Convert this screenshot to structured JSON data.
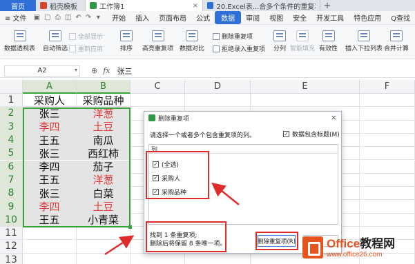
{
  "tabs": {
    "home": "首页",
    "items": [
      {
        "label": "稻壳模板",
        "color": "#d9472b",
        "active": false
      },
      {
        "label": "工作簿1",
        "color": "#2e9a45",
        "active": true
      },
      {
        "label": "20.Excel表...合多个条件的重复项",
        "color": "#2f6fd6",
        "active": false
      }
    ]
  },
  "menu": {
    "file": "≡ 文件",
    "items": [
      "开始",
      "插入",
      "页面布局",
      "公式",
      "数据",
      "审阅",
      "视图",
      "安全",
      "开发工具",
      "特色应用",
      "Q查找"
    ],
    "active": "数据"
  },
  "ribbon": {
    "pivot": "数据透视表",
    "autofilter": "自动筛选",
    "show_all": "全部显示",
    "reapply": "重新应用",
    "sort": "排序",
    "highlight_dup": "高亮重复项",
    "compare": "数据对比",
    "remove_dup": "删除重复项",
    "reject_dup": "拒绝录入重复项",
    "split": "分列",
    "smart_fill": "智能填充",
    "validity": "有效性",
    "dropdown": "插入下拉列表",
    "consolidate": "合并计算"
  },
  "formula_bar": {
    "cell_ref": "A2",
    "fx": "fx",
    "value": "张三"
  },
  "grid": {
    "columns": [
      "A",
      "B",
      "C",
      "D",
      "E",
      "F"
    ],
    "rows": [
      "1",
      "2",
      "3",
      "4",
      "5",
      "6",
      "7",
      "8",
      "9",
      "10",
      "11",
      "12",
      "13"
    ],
    "data": [
      {
        "a": "采购人",
        "b": "采购品种",
        "a_red": false,
        "b_red": false
      },
      {
        "a": "张三",
        "b": "洋葱",
        "a_red": false,
        "b_red": true
      },
      {
        "a": "李四",
        "b": "土豆",
        "a_red": true,
        "b_red": true
      },
      {
        "a": "王五",
        "b": "南瓜",
        "a_red": false,
        "b_red": false
      },
      {
        "a": "张三",
        "b": "西红柿",
        "a_red": false,
        "b_red": false
      },
      {
        "a": "李四",
        "b": "茄子",
        "a_red": false,
        "b_red": false
      },
      {
        "a": "王五",
        "b": "洋葱",
        "a_red": false,
        "b_red": true
      },
      {
        "a": "张三",
        "b": "白菜",
        "a_red": false,
        "b_red": false
      },
      {
        "a": "李四",
        "b": "土豆",
        "a_red": true,
        "b_red": true
      },
      {
        "a": "王五",
        "b": "小青菜",
        "a_red": false,
        "b_red": false
      }
    ]
  },
  "dialog": {
    "title": "删除重复项",
    "close": "×",
    "description": "请选择一个或者多个包含重复项的列。",
    "header_check": "数据包含标题(M)",
    "list_header": "列",
    "items": [
      "(全选)",
      "采购人",
      "采购品种"
    ],
    "check_mark": "✓",
    "result_line1": "找到 1 条重复项;",
    "result_line2": "删除后将保留 8 条唯一项。",
    "remove_button": "删除重复项(R)"
  },
  "watermark": {
    "brand_a": "Office",
    "brand_b": "教程网",
    "url": "www.office26.com"
  },
  "colors": {
    "accent": "#2f6fd6",
    "selection": "#35a23a",
    "duplicate_red": "#e03a3a",
    "annotation": "#e02b2b"
  }
}
